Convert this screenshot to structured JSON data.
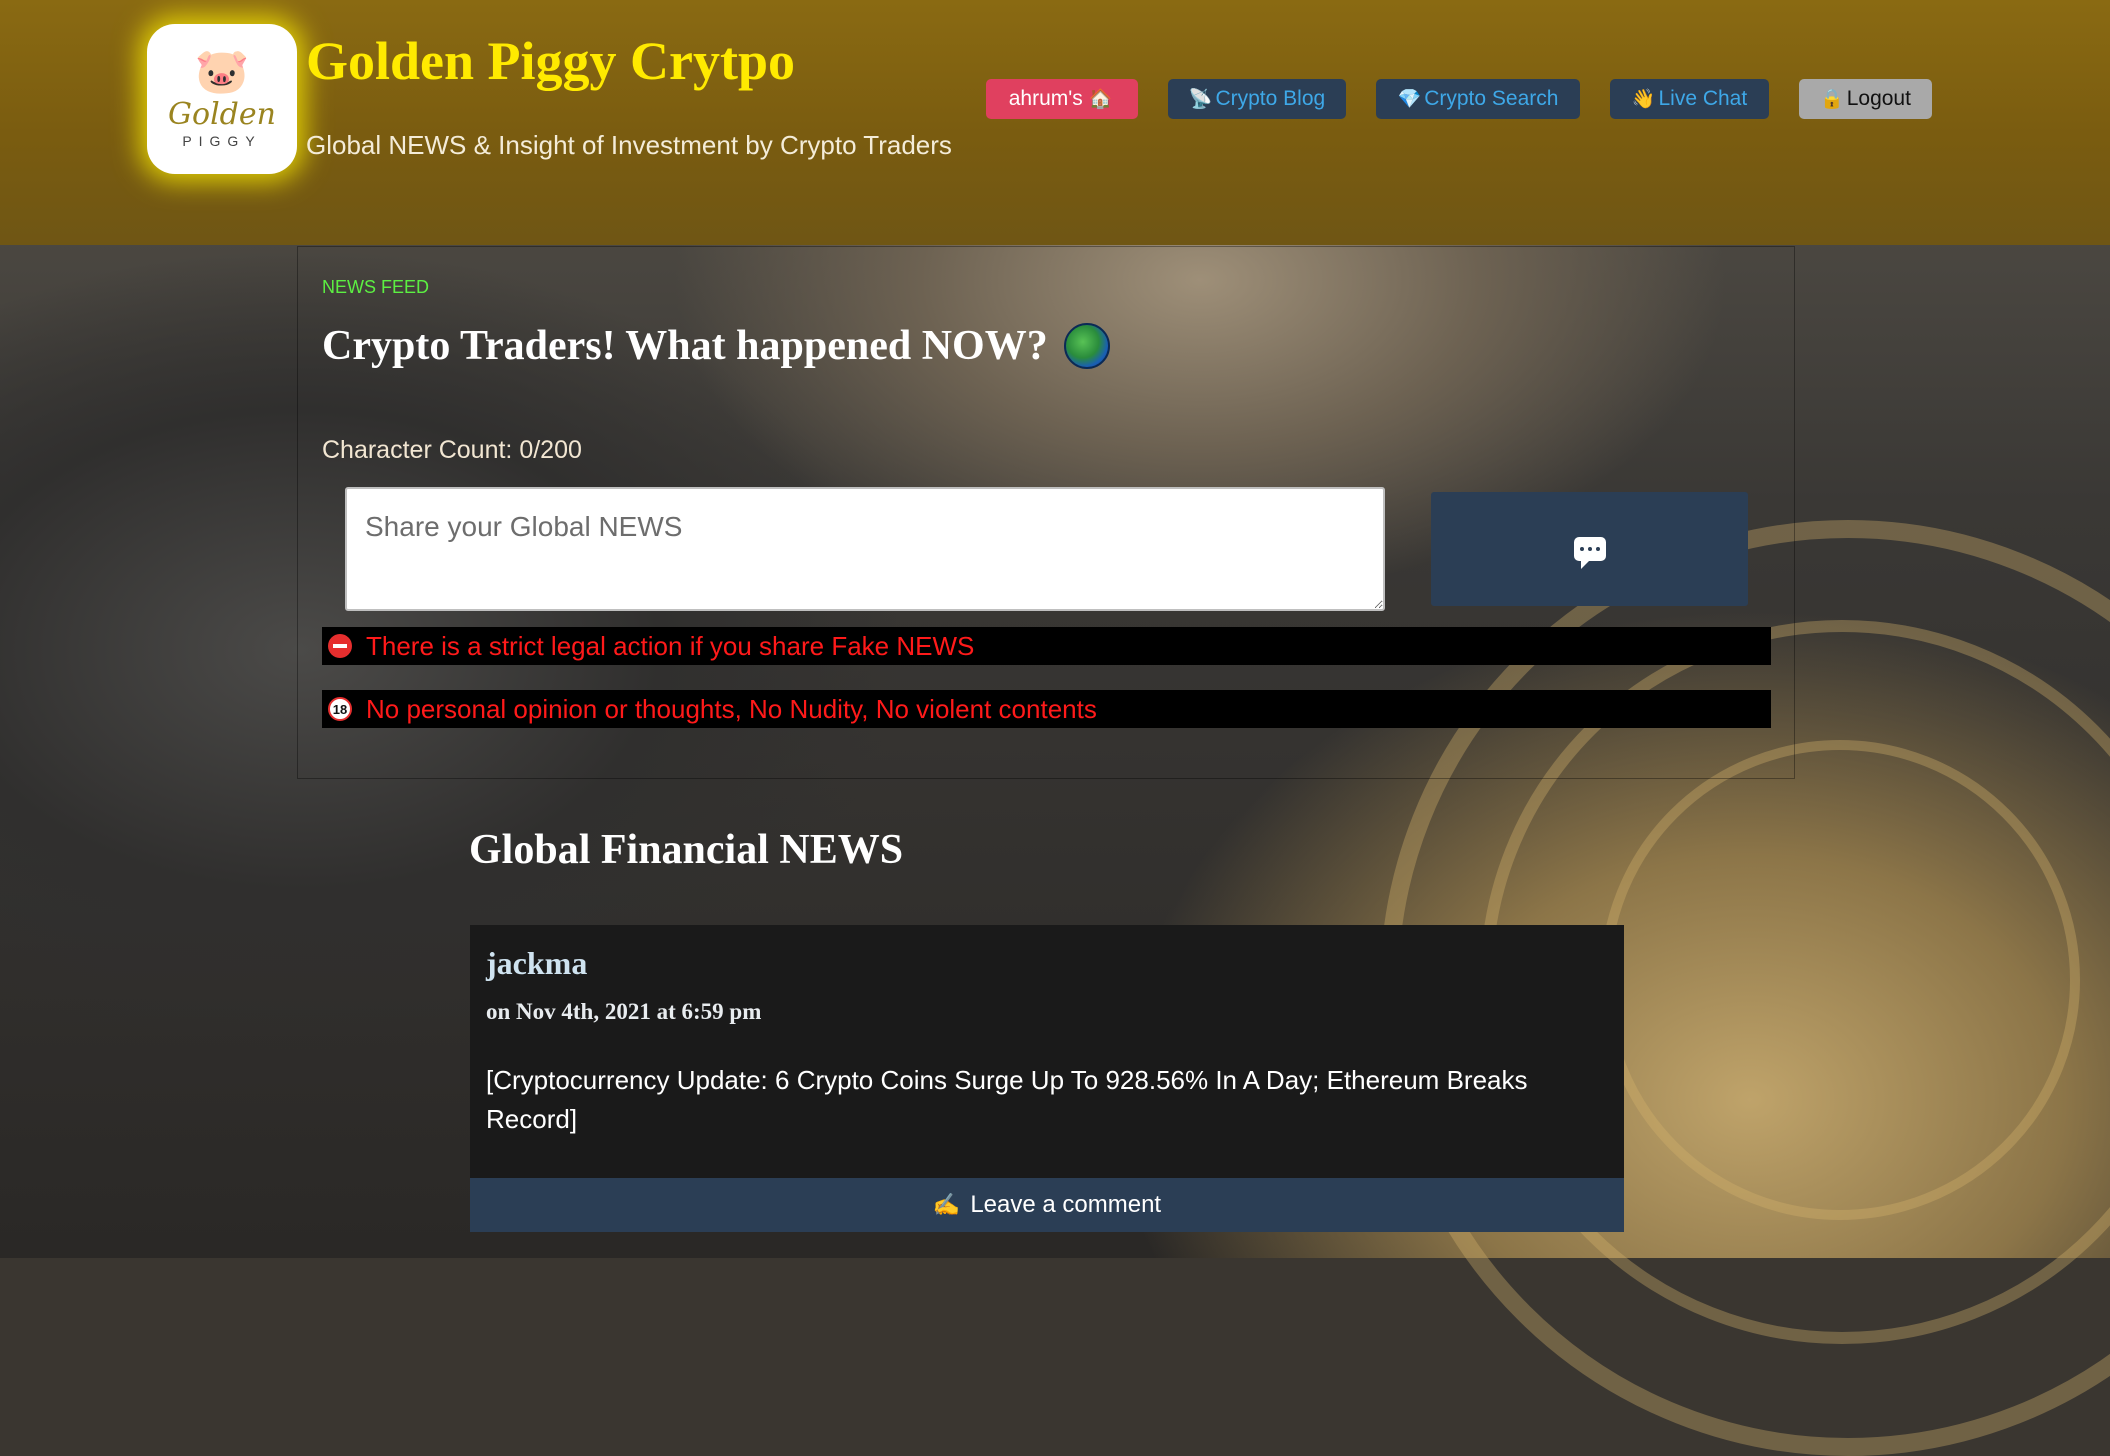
{
  "site": {
    "title": "Golden Piggy Crytpo",
    "subtitle": "Global NEWS & Insight of Investment by Crypto Traders",
    "logo": {
      "script": "Golden",
      "small": "PIGGY"
    }
  },
  "nav": {
    "user": {
      "label": "ahrum's",
      "icon": "🏠"
    },
    "blog": {
      "label": "Crypto Blog",
      "icon": "📡"
    },
    "search": {
      "label": "Crypto Search",
      "icon": "💎"
    },
    "chat": {
      "label": "Live Chat",
      "icon": "👋"
    },
    "logout": {
      "label": "Logout",
      "icon": "🔒"
    }
  },
  "feed": {
    "label": "NEWS FEED",
    "title": "Crypto Traders! What happened NOW?",
    "char_count": "Character Count: 0/200",
    "input_placeholder": "Share your Global NEWS",
    "warnings": [
      "There is a strict legal action if you share Fake NEWS",
      "No personal opinion or thoughts, No Nudity, No violent contents"
    ],
    "warning_badge_2": "18"
  },
  "news": {
    "section_title": "Global Financial NEWS",
    "posts": [
      {
        "author": "jackma",
        "date": "on Nov 4th, 2021 at 6:59 pm",
        "body": "[Cryptocurrency Update: 6 Crypto Coins Surge Up To 928.56% In A Day; Ethereum Breaks Record]",
        "comment_label": "Leave a comment",
        "comment_icon": "✍"
      }
    ]
  },
  "colors": {
    "header": "#7a5c10",
    "title_yellow": "#ffea00",
    "nav_dark": "#2b3e55",
    "nav_link": "#3ea8e8",
    "user_pink": "#e0405f",
    "feed_green": "#5cf042",
    "warning_red": "#ff1a1a"
  }
}
